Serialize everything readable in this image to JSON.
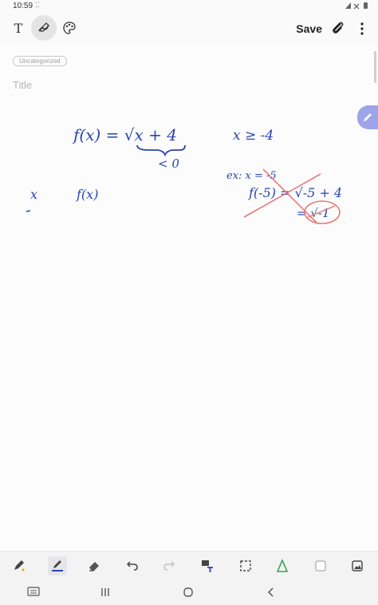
{
  "status_bar": {
    "time": "10:59",
    "dots": "⁚⁚"
  },
  "toolbar": {
    "save_label": "Save",
    "text_mode_label": "T"
  },
  "note": {
    "category": "Uncategorized",
    "title_placeholder": "Title"
  },
  "ink": {
    "line1_left": "f(x) = √x + 4",
    "under_root": "< 0",
    "line1_right": "x ≥ -4",
    "example": "ex: x = -5",
    "eval_line": "f(-5) = √-5 + 4",
    "result": "= √-1",
    "table_x": "x",
    "table_fx": "f(x)"
  },
  "colors": {
    "ink": "#2a44b0",
    "cross_out": "#e57a7a",
    "pen_tab": "#9da4e8",
    "eraser_accent": "#e0b400"
  },
  "icons": {
    "pen_mode": "pen-icon",
    "palette": "palette-icon",
    "attach": "paperclip-icon",
    "more": "more-vertical-icon"
  }
}
